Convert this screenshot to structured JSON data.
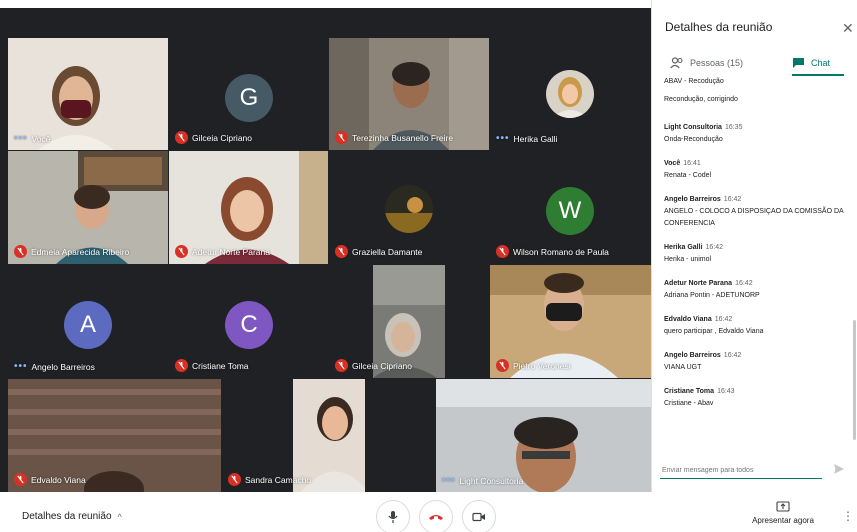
{
  "panel": {
    "title": "Detalhes da reunião",
    "tabs": {
      "people": "Pessoas (15)",
      "chat": "Chat"
    },
    "input_placeholder": "Enviar mensagem para todos"
  },
  "chat": {
    "first_lines": [
      "ABAV - Recodução",
      "Recondução, corrigindo"
    ],
    "messages": [
      {
        "sender": "Light Consultoria",
        "time": "16:35",
        "text": "Onda-Recondução"
      },
      {
        "sender": "Você",
        "time": "16:41",
        "text": "Renata - Codel"
      },
      {
        "sender": "Angelo Barreiros",
        "time": "16:42",
        "text": "ANGELO - COLOCO A DISPOSIÇAO DA COMISSÃO DA CONFERENCIA"
      },
      {
        "sender": "Herika Galli",
        "time": "16:42",
        "text": "Herika - unimol"
      },
      {
        "sender": "Adetur Norte Parana",
        "time": "16:42",
        "text": "Adriana Pontin - ADETUNORP"
      },
      {
        "sender": "Edvaldo Viana",
        "time": "16:42",
        "text": "quero participar , Edvaldo Viana"
      },
      {
        "sender": "Angelo Barreiros",
        "time": "16:42",
        "text": "VIANA UGT"
      },
      {
        "sender": "Cristiane Toma",
        "time": "16:43",
        "text": "Cristiane - Abav"
      }
    ]
  },
  "participants": [
    {
      "name": "Você",
      "status": "speaking"
    },
    {
      "name": "Gilceia Cipriano",
      "status": "muted",
      "initial": "G",
      "color": "#455a64"
    },
    {
      "name": "Terezinha Busanello Freire",
      "status": "muted"
    },
    {
      "name": "Herika Galli",
      "status": "speaking"
    },
    {
      "name": "Edmeia Aparecida Ribeiro",
      "status": "muted"
    },
    {
      "name": "Adetur Norte Parana",
      "status": "muted"
    },
    {
      "name": "Graziella Damante",
      "status": "muted"
    },
    {
      "name": "Wilson Romano de Paula",
      "status": "muted",
      "initial": "W",
      "color": "#2e7d32"
    },
    {
      "name": "Angelo Barreiros",
      "status": "speaking",
      "initial": "A",
      "color": "#5c6bc0"
    },
    {
      "name": "Cristiane Toma",
      "status": "muted",
      "initial": "C",
      "color": "#7e57c2"
    },
    {
      "name": "Gilceia Cipriano",
      "status": "muted"
    },
    {
      "name": "Pietro Veronesi",
      "status": "muted"
    },
    {
      "name": "Edvaldo Viana",
      "status": "muted"
    },
    {
      "name": "Sandra Camacho",
      "status": "muted"
    },
    {
      "name": "Light Consultoria",
      "status": "speaking"
    }
  ],
  "bottom": {
    "details_label": "Detalhes da reunião",
    "present_label": "Apresentar agora"
  }
}
